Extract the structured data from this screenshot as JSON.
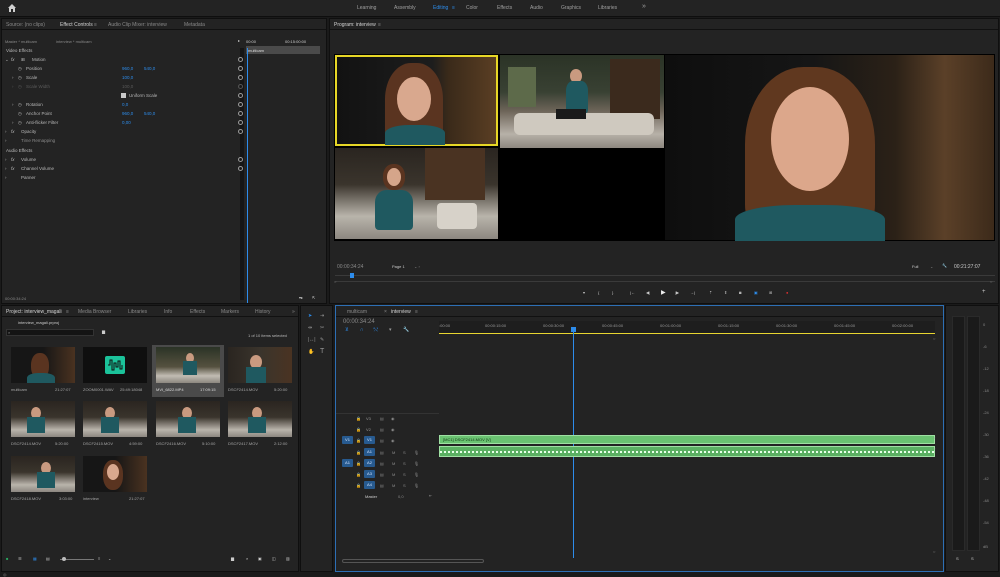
{
  "workspaces": {
    "items": [
      "Learning",
      "Assembly",
      "Editing",
      "Color",
      "Effects",
      "Audio",
      "Graphics",
      "Libraries"
    ],
    "active": "Editing",
    "more": "»"
  },
  "source_panel": {
    "tabs": [
      "Source: (no clips)",
      "Effect Controls",
      "Audio Clip Mixer: interview",
      "Metadata"
    ],
    "master_label": "Master * multicam",
    "sequence_label": "interview * multicam",
    "ruler_start": "00:00",
    "ruler_end": "00:15:00:00",
    "clip_tag": "multicam",
    "sections": {
      "video": "Video Effects",
      "audio": "Audio Effects"
    },
    "props": [
      {
        "name": "Motion",
        "fx": "fx"
      },
      {
        "name": "Position",
        "v1": "960,0",
        "v2": "540,0"
      },
      {
        "name": "Scale",
        "v1": "100,0"
      },
      {
        "name": "Scale Width",
        "v1": "100,0"
      },
      {
        "name": "Uniform Scale"
      },
      {
        "name": "Rotation",
        "v1": "0,0"
      },
      {
        "name": "Anchor Point",
        "v1": "960,0",
        "v2": "540,0"
      },
      {
        "name": "Anti-flicker Filter",
        "v1": "0,00"
      },
      {
        "name": "Opacity",
        "fx": "fx"
      },
      {
        "name": "Time Remapping"
      },
      {
        "name": "Volume",
        "fx": "fx"
      },
      {
        "name": "Channel Volume",
        "fx": "fx"
      },
      {
        "name": "Panner"
      }
    ],
    "timecode": "00:00:34:24"
  },
  "program": {
    "title": "Program: interview",
    "timecode": "00:00:34:24",
    "page": "Page 1",
    "zoom": "Full",
    "duration": "00:21:27:07"
  },
  "project": {
    "tabs": [
      "Project: interview_magali",
      "Media Browser",
      "Libraries",
      "Info",
      "Effects",
      "Markers",
      "History"
    ],
    "file": "interview_magali.prproj",
    "count": "1 of 10 items selected",
    "items": [
      {
        "name": "multicam",
        "dur": "21:27:07"
      },
      {
        "name": "ZOOM0001.WAV",
        "dur": "25:49:18048"
      },
      {
        "name": "MVI_6822.MP4",
        "dur": "17:09:15"
      },
      {
        "name": "DSCF2414.MOV",
        "dur": "5:20:00"
      },
      {
        "name": "DSCF2414.MOV",
        "dur": "5:20:00"
      },
      {
        "name": "DSCF2415.MOV",
        "dur": "4:59:00"
      },
      {
        "name": "DSCF2416.MOV",
        "dur": "5:10:00"
      },
      {
        "name": "DSCF2417.MOV",
        "dur": "2:12:00"
      },
      {
        "name": "DSCF2418.MOV",
        "dur": "3:03:00"
      },
      {
        "name": "interview",
        "dur": "21:27:07"
      }
    ]
  },
  "timeline": {
    "tabs": [
      "multicam",
      "interview"
    ],
    "timecode": "00:00:34:24",
    "ruler": [
      ":00:00",
      "00:00:15:00",
      "00:00:30:00",
      "00:00:45:00",
      "00:01:00:00",
      "00:01:15:00",
      "00:01:30:00",
      "00:01:45:00",
      "00:02:00:00"
    ],
    "tracks": [
      "V3",
      "V2",
      "V1",
      "A1",
      "A2",
      "A3",
      "A4"
    ],
    "src_v": "V1",
    "src_a": "A1",
    "master": "Master",
    "master_val": "0,0",
    "clip_label": "[MC1] DSCF2414.MOV [V]"
  },
  "meter": {
    "scale": [
      "0",
      "-6",
      "-12",
      "-18",
      "-24",
      "-30",
      "-36",
      "-42",
      "-48",
      "-54",
      "dB"
    ],
    "bottom": [
      "S",
      "S"
    ]
  }
}
